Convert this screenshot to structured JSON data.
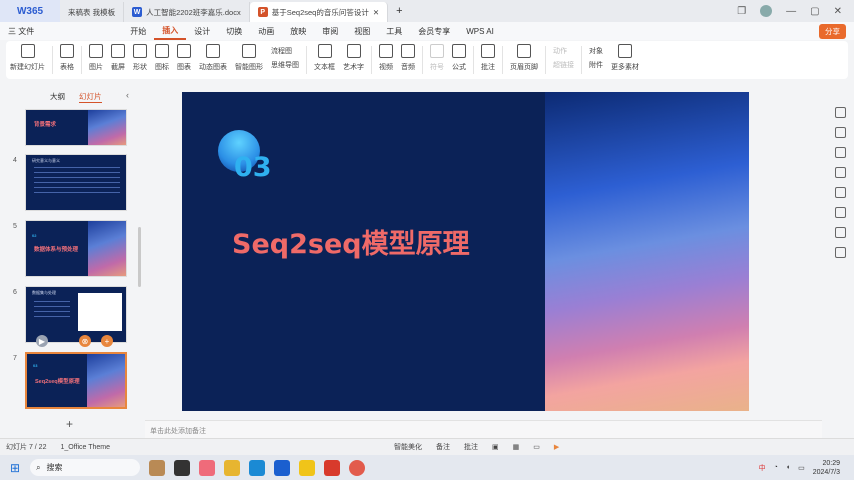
{
  "window": {
    "logo": "W365",
    "tabs": [
      {
        "label": "来稿表 我模板",
        "icon": "",
        "color": "",
        "active": false
      },
      {
        "label": "人工智能2202班李嘉乐.docx",
        "icon": "W",
        "color": "#2b5cd1",
        "active": false
      },
      {
        "label": "基于Seq2seq的音乐问答设计",
        "icon": "P",
        "color": "#d4532a",
        "active": true
      }
    ]
  },
  "menubar": {
    "file": "三 文件",
    "items": [
      "开始",
      "插入",
      "设计",
      "切换",
      "动画",
      "放映",
      "审阅",
      "视图",
      "工具",
      "会员专享"
    ],
    "active": "插入",
    "wps_ai": "WPS AI",
    "share": "分享"
  },
  "ribbon": {
    "new_slide": "新建幻灯片",
    "table": "表格",
    "image": "图片",
    "screenshot": "截屏",
    "shape": "形状",
    "icon": "图标",
    "chart": "图表",
    "dynamic_chart": "动态图表",
    "smart_shape": "智能图形",
    "flowchart": "流程图",
    "mindmap": "思维导图",
    "textbox": "文本框",
    "wordart": "艺术字",
    "video": "视频",
    "audio": "音频",
    "symbol": "符号",
    "formula": "公式",
    "comment": "批注",
    "header_footer": "页眉页脚",
    "action": "动作",
    "hyperlink": "超链接",
    "object": "对象",
    "attachment": "附件",
    "more": "更多素材"
  },
  "sidepanel": {
    "tab_outline": "大纲",
    "tab_slides": "幻灯片",
    "add_slide": "+",
    "thumbs": [
      {
        "num": "",
        "title": "背景需求"
      },
      {
        "num": "4",
        "title": "研究意义与意义"
      },
      {
        "num": "5",
        "title": "数据体系与预处理",
        "sub": "02"
      },
      {
        "num": "6",
        "title": "数据集与处理"
      },
      {
        "num": "7",
        "title": "Seq2seq模型原理",
        "sub": "03"
      }
    ]
  },
  "slide": {
    "number": "03",
    "title": "Seq2seq模型原理"
  },
  "notes": {
    "placeholder": "单击此处添加备注"
  },
  "statusbar": {
    "slide_counter": "幻灯片 7 / 22",
    "theme": "1_Office Theme",
    "beautify": "智能美化",
    "notes_btn": "备注",
    "comment_btn": "批注"
  },
  "taskbar": {
    "search": "搜索",
    "time": "20:29",
    "date": "2024/7/3",
    "ime": "中"
  }
}
